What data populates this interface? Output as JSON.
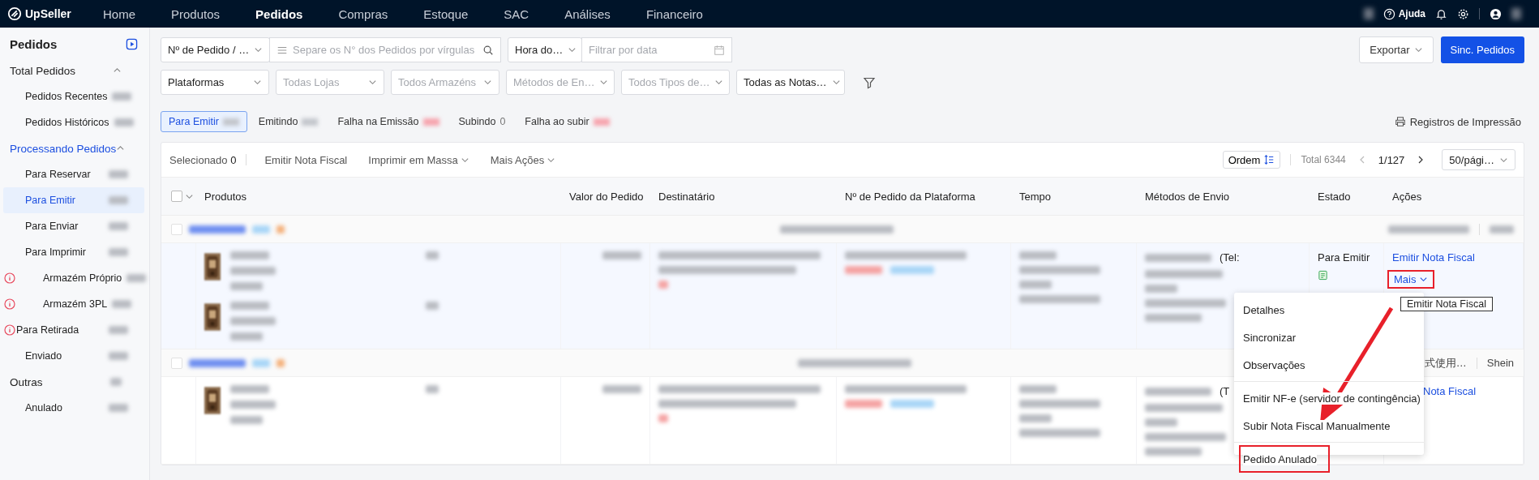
{
  "nav": {
    "logo": "UpSeller",
    "items": [
      {
        "label": "Home",
        "selected": false
      },
      {
        "label": "Produtos",
        "selected": false
      },
      {
        "label": "Pedidos",
        "selected": true
      },
      {
        "label": "Compras",
        "selected": false
      },
      {
        "label": "Estoque",
        "selected": false
      },
      {
        "label": "SAC",
        "selected": false
      },
      {
        "label": "Análises",
        "selected": false
      },
      {
        "label": "Financeiro",
        "selected": false
      }
    ],
    "help": "Ajuda"
  },
  "sidebar": {
    "title": "Pedidos",
    "sections": [
      {
        "label": "Total Pedidos",
        "current": false,
        "expanded": true,
        "children": [
          {
            "label": "Pedidos Recentes",
            "selected": false,
            "warning": false
          },
          {
            "label": "Pedidos Históricos",
            "selected": false,
            "warning": false
          }
        ]
      },
      {
        "label": "Processando Pedidos",
        "current": true,
        "expanded": true,
        "children": [
          {
            "label": "Para Reservar",
            "selected": false,
            "warning": false
          },
          {
            "label": "Para Emitir",
            "selected": true,
            "warning": false
          },
          {
            "label": "Para Enviar",
            "selected": false,
            "warning": false
          },
          {
            "label": "Para Imprimir",
            "selected": false,
            "warning": false,
            "children": [
              {
                "label": "Armazém Próprio",
                "selected": false,
                "warning": true
              },
              {
                "label": "Armazém 3PL",
                "selected": false,
                "warning": true
              }
            ]
          },
          {
            "label": "Para Retirada",
            "selected": false,
            "warning": true
          },
          {
            "label": "Enviado",
            "selected": false,
            "warning": false
          }
        ]
      },
      {
        "label": "Outras",
        "current": false,
        "children": [
          {
            "label": "Anulado",
            "selected": false,
            "warning": false
          }
        ]
      }
    ]
  },
  "filters": {
    "row_1": [
      {
        "kind": "select",
        "value": "Nº de Pedido / …"
      },
      {
        "kind": "search",
        "placeholder": "Separe os N° dos Pedidos por vírgulas"
      },
      {
        "kind": "select",
        "value": "Hora do…"
      },
      {
        "kind": "date",
        "placeholder": "Filtrar por data"
      }
    ],
    "row_2": [
      {
        "kind": "select",
        "value": "Plataformas"
      },
      {
        "kind": "select",
        "placeholder": "Todas Lojas"
      },
      {
        "kind": "select",
        "placeholder": "Todos Armazéns"
      },
      {
        "kind": "select",
        "placeholder": "Métodos de En…"
      },
      {
        "kind": "select",
        "placeholder": "Todos Tipos de…"
      },
      {
        "kind": "select",
        "value": "Todas as Notas…"
      }
    ]
  },
  "buttons": [
    {
      "label": "Exportar",
      "kind": "dropdown"
    },
    {
      "label": "Sinc. Pedidos",
      "kind": "primary"
    }
  ],
  "tabs": [
    {
      "label": "Para Emitir",
      "selected": true,
      "color": "#c3c6cc"
    },
    {
      "label": "Emitindo",
      "selected": false,
      "color": "#c3c6cc"
    },
    {
      "label": "Falha na Emissão",
      "selected": false,
      "color": "#f7a3ad"
    },
    {
      "label": "Subindo",
      "selected": false,
      "count": "0"
    },
    {
      "label": "Falha ao subir",
      "selected": false,
      "color": "#f7a3ad"
    }
  ],
  "print_log": "Registros de Impressão",
  "toolbar": {
    "selected_label": "Selecionado",
    "selected_count": "0",
    "actions": [
      {
        "label": "Emitir Nota Fiscal",
        "dropdown": false
      },
      {
        "label": "Imprimir em Massa",
        "dropdown": true
      },
      {
        "label": "Mais Ações",
        "dropdown": true
      }
    ],
    "sort": "Ordem",
    "total": "Total 6344",
    "page": "1/127",
    "page_size": "50/pági…"
  },
  "table": {
    "select_all": {
      "checked": false
    },
    "columns": [
      "Produtos",
      "Valor do Pedido",
      "Destinatário",
      "Nº de Pedido da Plataforma",
      "Tempo",
      "Métodos de Envio",
      "Estado",
      "Ações"
    ],
    "rows": [
      {
        "kind": "group",
        "checked": false
      },
      {
        "kind": "order",
        "hovered": true,
        "products": [
          {
            "kind": "item"
          },
          {
            "kind": "item"
          }
        ],
        "shipping": "(Tel:",
        "status": "Para Emitir",
        "action": "Emitir Nota Fiscal",
        "more": "Mais",
        "more_highlighted": true
      },
      {
        "kind": "group",
        "checked": false,
        "store": "式使用…",
        "platform": "Shein"
      },
      {
        "kind": "order",
        "hovered": false,
        "products": [
          {
            "kind": "item"
          }
        ],
        "shipping": "(T",
        "action": "Nota Fiscal"
      }
    ]
  },
  "tooltip": "Emitir Nota Fiscal",
  "menu": [
    {
      "label": "Detalhes",
      "divider_before": false,
      "highlighted": false
    },
    {
      "label": "Sincronizar",
      "divider_before": false,
      "highlighted": false
    },
    {
      "label": "Observações",
      "divider_before": false,
      "highlighted": false
    },
    {
      "label": "Emitir NF-e (servidor de contingência)",
      "divider_before": true,
      "highlighted": false
    },
    {
      "label": "Subir Nota Fiscal Manualmente",
      "divider_before": false,
      "highlighted": false
    },
    {
      "label": "Pedido Anulado",
      "divider_before": true,
      "highlighted": true
    }
  ]
}
